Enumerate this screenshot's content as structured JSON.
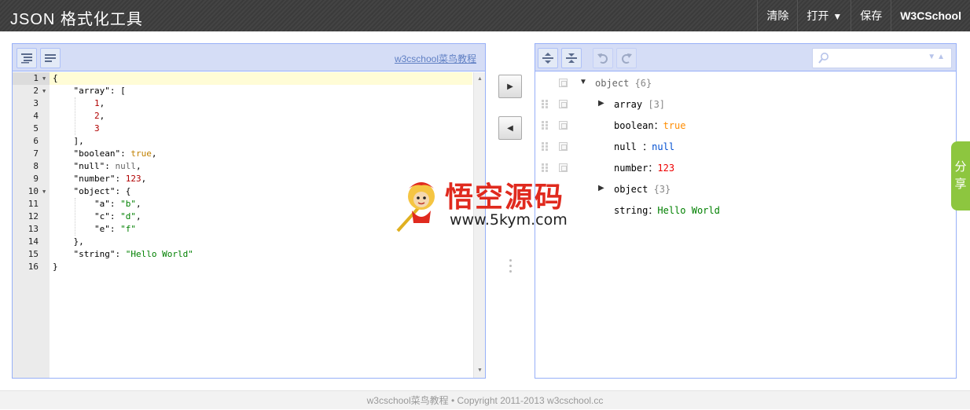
{
  "header": {
    "title": "JSON 格式化工具",
    "menu": {
      "clear": "清除",
      "open": "打开",
      "open_caret": "▼",
      "save": "保存",
      "site": "W3CSchool"
    }
  },
  "code_panel": {
    "link": "w3cschool菜鸟教程",
    "toolbar_icons": [
      "format-icon",
      "compact-icon"
    ],
    "line_numbers": [
      "1",
      "2",
      "3",
      "4",
      "5",
      "6",
      "7",
      "8",
      "9",
      "10",
      "11",
      "12",
      "13",
      "14",
      "15",
      "16"
    ],
    "fold_marker": "▼",
    "lines": [
      [
        {
          "t": "{",
          "c": "p"
        }
      ],
      [
        {
          "t": "    ",
          "c": "p"
        },
        {
          "t": "\"array\"",
          "c": "k"
        },
        {
          "t": ": [",
          "c": "p"
        }
      ],
      [
        {
          "t": "        ",
          "c": "p"
        },
        {
          "t": "1",
          "c": "n"
        },
        {
          "t": ",",
          "c": "p"
        }
      ],
      [
        {
          "t": "        ",
          "c": "p"
        },
        {
          "t": "2",
          "c": "n"
        },
        {
          "t": ",",
          "c": "p"
        }
      ],
      [
        {
          "t": "        ",
          "c": "p"
        },
        {
          "t": "3",
          "c": "n"
        }
      ],
      [
        {
          "t": "    ],",
          "c": "p"
        }
      ],
      [
        {
          "t": "    ",
          "c": "p"
        },
        {
          "t": "\"boolean\"",
          "c": "k"
        },
        {
          "t": ": ",
          "c": "p"
        },
        {
          "t": "true",
          "c": "b"
        },
        {
          "t": ",",
          "c": "p"
        }
      ],
      [
        {
          "t": "    ",
          "c": "p"
        },
        {
          "t": "\"null\"",
          "c": "k"
        },
        {
          "t": ": ",
          "c": "p"
        },
        {
          "t": "null",
          "c": "u"
        },
        {
          "t": ",",
          "c": "p"
        }
      ],
      [
        {
          "t": "    ",
          "c": "p"
        },
        {
          "t": "\"number\"",
          "c": "k"
        },
        {
          "t": ": ",
          "c": "p"
        },
        {
          "t": "123",
          "c": "n"
        },
        {
          "t": ",",
          "c": "p"
        }
      ],
      [
        {
          "t": "    ",
          "c": "p"
        },
        {
          "t": "\"object\"",
          "c": "k"
        },
        {
          "t": ": {",
          "c": "p"
        }
      ],
      [
        {
          "t": "        ",
          "c": "p"
        },
        {
          "t": "\"a\"",
          "c": "k"
        },
        {
          "t": ": ",
          "c": "p"
        },
        {
          "t": "\"b\"",
          "c": "s"
        },
        {
          "t": ",",
          "c": "p"
        }
      ],
      [
        {
          "t": "        ",
          "c": "p"
        },
        {
          "t": "\"c\"",
          "c": "k"
        },
        {
          "t": ": ",
          "c": "p"
        },
        {
          "t": "\"d\"",
          "c": "s"
        },
        {
          "t": ",",
          "c": "p"
        }
      ],
      [
        {
          "t": "        ",
          "c": "p"
        },
        {
          "t": "\"e\"",
          "c": "k"
        },
        {
          "t": ": ",
          "c": "p"
        },
        {
          "t": "\"f\"",
          "c": "s"
        }
      ],
      [
        {
          "t": "    },",
          "c": "p"
        }
      ],
      [
        {
          "t": "    ",
          "c": "p"
        },
        {
          "t": "\"string\"",
          "c": "k"
        },
        {
          "t": ": ",
          "c": "p"
        },
        {
          "t": "\"Hello World\"",
          "c": "s"
        }
      ],
      [
        {
          "t": "}",
          "c": "p"
        }
      ]
    ]
  },
  "transfer": {
    "to_tree": "▶",
    "to_code": "◀"
  },
  "tree_panel": {
    "search_placeholder": "",
    "search_arrows": "▼▲",
    "root": {
      "field": "object",
      "count": "{6}",
      "expander": "▼"
    },
    "rows": [
      {
        "field": "array",
        "count": "[3]",
        "expander": "▶",
        "value": "",
        "type": ""
      },
      {
        "field": "boolean",
        "sep": "：",
        "value": "true",
        "type": "bool"
      },
      {
        "field": "null",
        "sep": " ：",
        "value": "null",
        "type": "null"
      },
      {
        "field": "number",
        "sep": "：",
        "value": "123",
        "type": "num"
      },
      {
        "field": "object",
        "count": "{3}",
        "expander": "▶",
        "value": "",
        "type": ""
      },
      {
        "field": "string",
        "sep": "：",
        "value": "Hello World",
        "type": "str"
      }
    ]
  },
  "share": {
    "label_1": "分",
    "label_2": "享"
  },
  "watermark": {
    "cn": "悟空源码",
    "url": "www.5kym.com"
  },
  "footer": {
    "text": "w3cschool菜鸟教程 • Copyright 2011-2013 w3cschool.cc"
  }
}
